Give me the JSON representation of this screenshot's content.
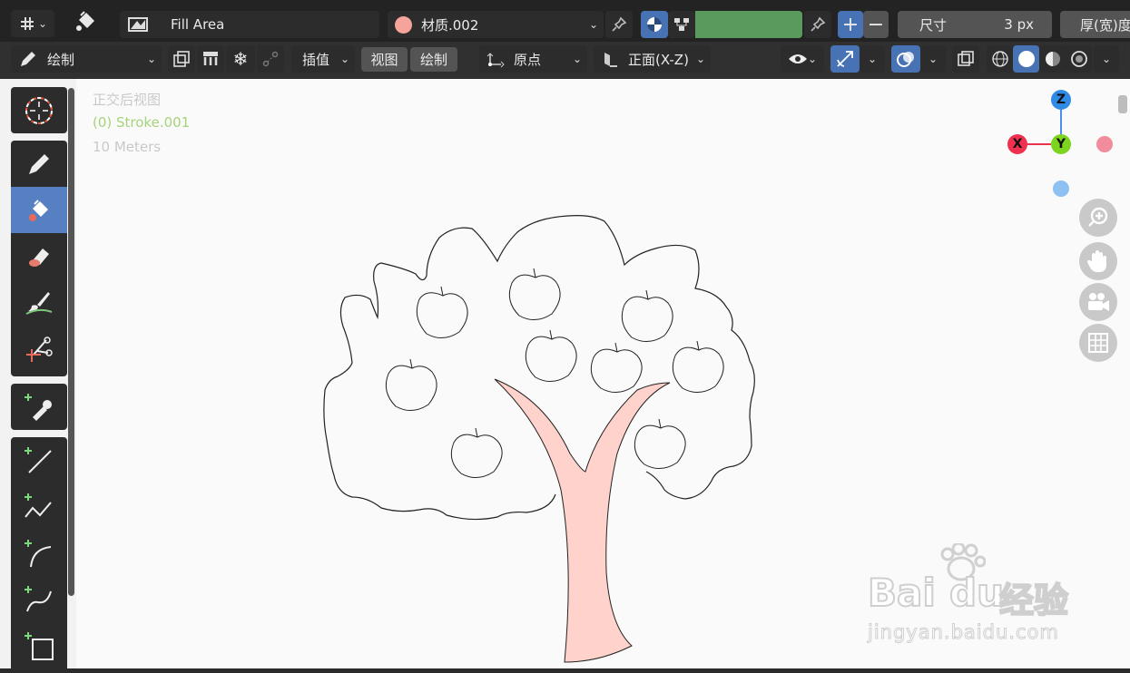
{
  "topbar": {
    "object_name": "Fill Area",
    "material_name": "材质.002",
    "material_color": "#f4a49a",
    "color_swatch": "#5a9b5d",
    "size_label": "尺寸",
    "size_value": "3 px",
    "thickness_label": "厚(宽)度"
  },
  "toolbar": {
    "mode": "绘制",
    "interpolate": "插值",
    "view_menu": "视图",
    "draw_menu": "绘制",
    "origin": "原点",
    "plane": "正面(X-Z)"
  },
  "viewport": {
    "view_name": "正交后视图",
    "object_label": "(0) Stroke.001",
    "scale": "10 Meters",
    "axis_z": "Z",
    "axis_y": "Y",
    "axis_x": "X",
    "background": "#fafafa",
    "trunk_fill": "#ffd3cb"
  },
  "watermark": {
    "brand": "Bai",
    "brand2": "du",
    "suffix": "经验",
    "url": "jingyan.baidu.com"
  }
}
